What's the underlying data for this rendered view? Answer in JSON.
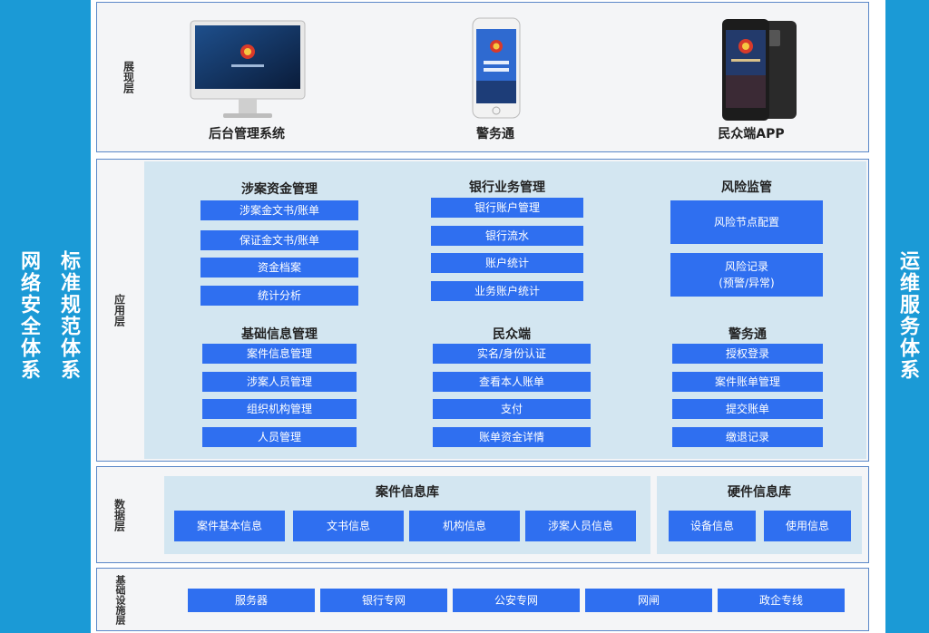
{
  "left_bar": {
    "col1": "网络安全体系",
    "col2": "标准规范体系"
  },
  "right_bar": {
    "col1": "运维服务体系"
  },
  "presentation": {
    "label": "展现层",
    "items": [
      {
        "name": "后台管理系统",
        "icon": "desktop-monitor-icon"
      },
      {
        "name": "警务通",
        "icon": "smartphone-icon"
      },
      {
        "name": "民众端APP",
        "icon": "rugged-phone-icon"
      }
    ]
  },
  "application": {
    "label": "应用层",
    "groups": [
      {
        "title": "涉案资金管理",
        "items": [
          "涉案金文书/账单",
          "保证金文书/账单",
          "资金档案",
          "统计分析"
        ]
      },
      {
        "title": "银行业务管理",
        "items": [
          "银行账户管理",
          "银行流水",
          "账户统计",
          "业务账户统计"
        ]
      },
      {
        "title": "风险监管",
        "items": [
          "风险节点配置",
          "风险记录",
          "(预警/异常)"
        ]
      },
      {
        "title": "基础信息管理",
        "items": [
          "案件信息管理",
          "涉案人员管理",
          "组织机构管理",
          "人员管理"
        ]
      },
      {
        "title": "民众端",
        "items": [
          "实名/身份认证",
          "查看本人账单",
          "支付",
          "账单资金详情"
        ]
      },
      {
        "title": "警务通",
        "items": [
          "授权登录",
          "案件账单管理",
          "提交账单",
          "缴退记录"
        ]
      }
    ]
  },
  "data": {
    "label": "数据层",
    "case_db": {
      "title": "案件信息库",
      "items": [
        "案件基本信息",
        "文书信息",
        "机构信息",
        "涉案人员信息"
      ]
    },
    "hw_db": {
      "title": "硬件信息库",
      "items": [
        "设备信息",
        "使用信息"
      ]
    }
  },
  "infra": {
    "label": "基础设施层",
    "items": [
      "服务器",
      "银行专网",
      "公安专网",
      "网闸",
      "政企专线"
    ]
  },
  "colors": {
    "side": "#1b9ad6",
    "box": "#2f6ff0",
    "panel": "#d3e6f1",
    "layer_bg": "#f4f5f7",
    "border": "#5a87c8"
  }
}
